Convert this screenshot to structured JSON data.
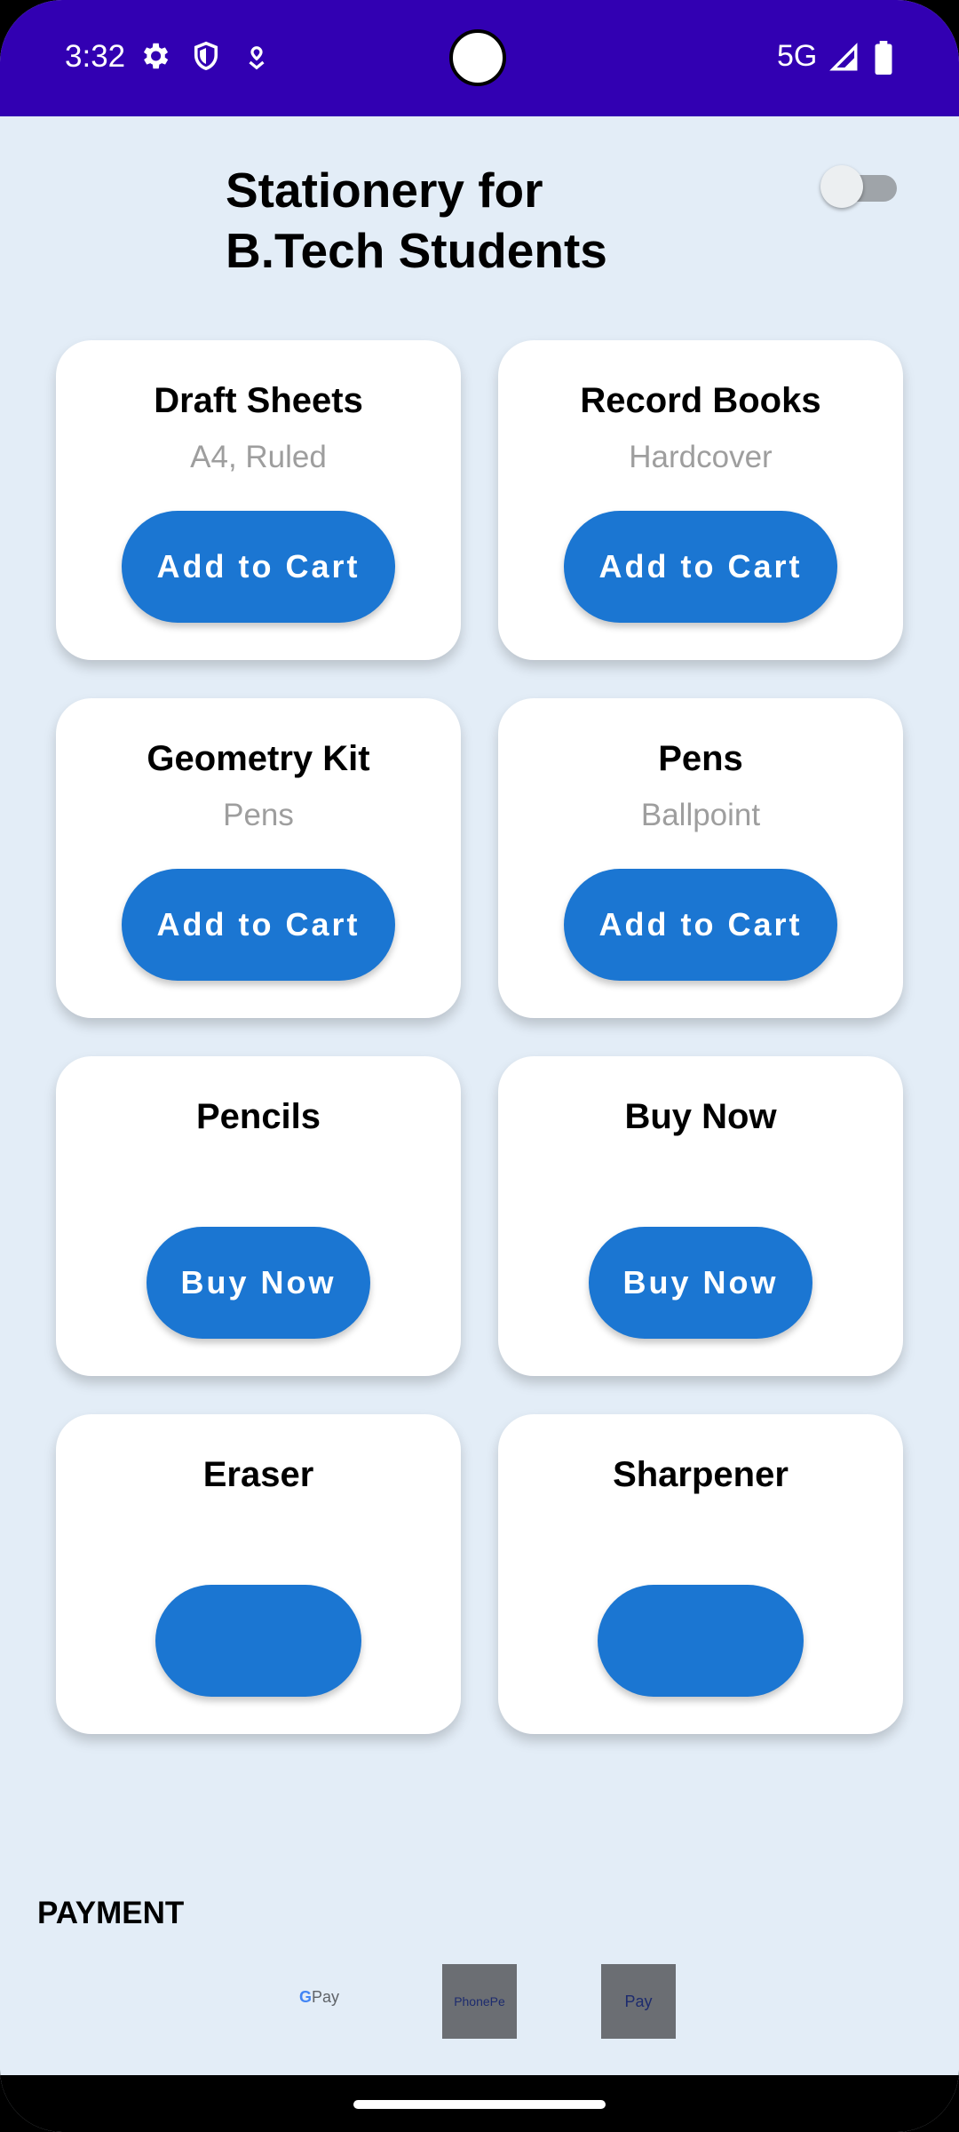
{
  "status_bar": {
    "time": "3:32",
    "network": "5G"
  },
  "header": {
    "title_line1": "Stationery for",
    "title_line2": "B.Tech Students"
  },
  "toggle": {
    "state": "off"
  },
  "products": [
    {
      "name": "Draft Sheets",
      "detail": "A4, Ruled",
      "button": "Add to Cart"
    },
    {
      "name": "Record Books",
      "detail": "Hardcover",
      "button": "Add to Cart"
    },
    {
      "name": "Geometry Kit",
      "detail": "Pens",
      "button": "Add to Cart"
    },
    {
      "name": "Pens",
      "detail": "Ballpoint",
      "button": "Add to Cart"
    },
    {
      "name": "Pencils",
      "button": "Buy Now"
    },
    {
      "name": "Buy Now",
      "button": "Buy Now"
    },
    {
      "name": "Eraser"
    },
    {
      "name": "Sharpener"
    }
  ],
  "payment": {
    "label": "PAYMENT",
    "methods": [
      {
        "name": "gpay-logo",
        "g": "G",
        "text": "Pay"
      },
      {
        "name": "phonepe-logo",
        "text": "PhonePe"
      },
      {
        "name": "paytm-logo",
        "text": "Pay"
      }
    ]
  },
  "colors": {
    "status_bar": "#3200b2",
    "background": "#e3edf7",
    "button": "#1b76d2",
    "subtitle": "#9e9e9e"
  }
}
